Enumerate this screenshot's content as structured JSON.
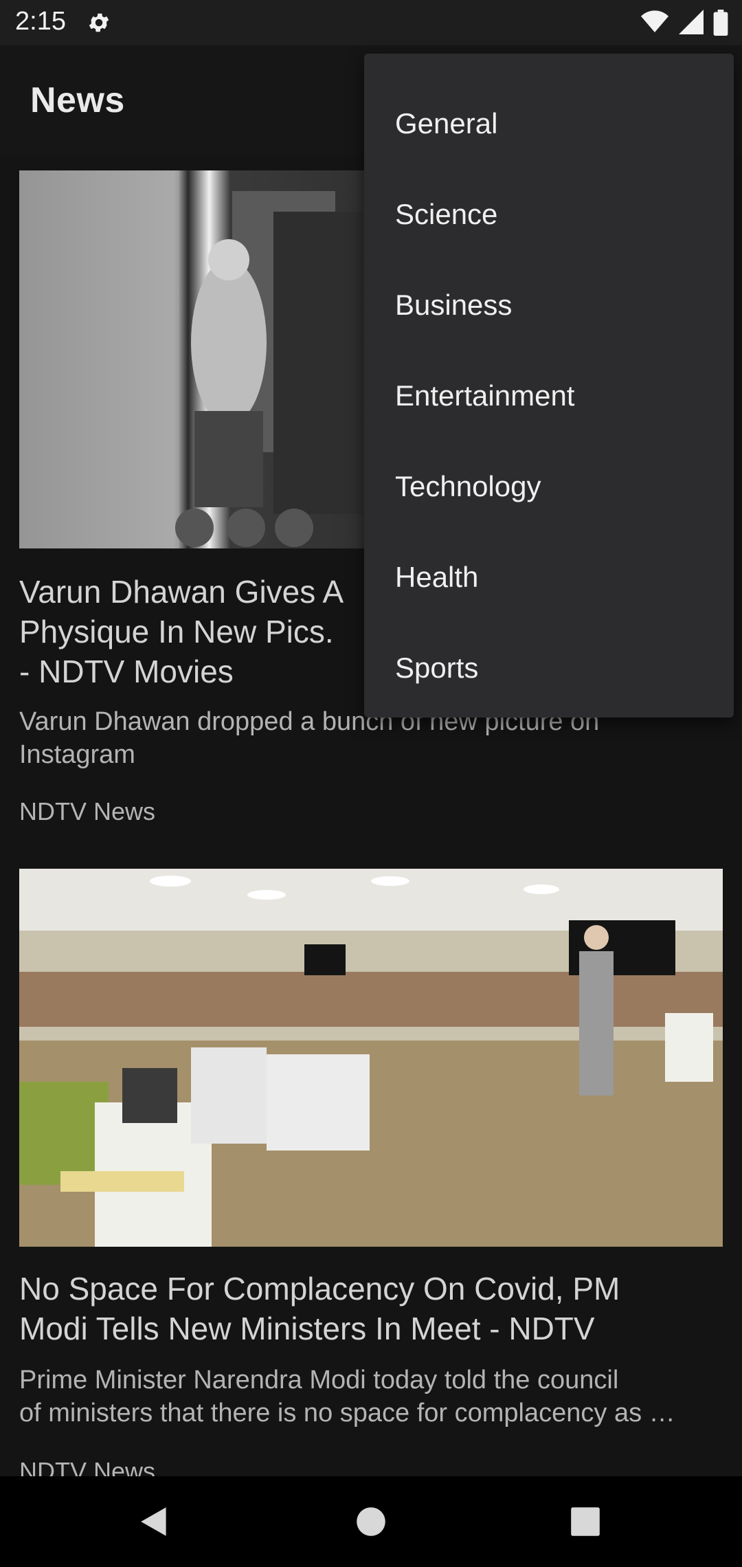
{
  "status_bar": {
    "time": "2:15",
    "icons": [
      "gear-icon",
      "wifi-icon",
      "signal-icon",
      "battery-icon"
    ]
  },
  "app_bar": {
    "title": "News"
  },
  "menu": {
    "items": [
      "General",
      "Science",
      "Business",
      "Entertainment",
      "Technology",
      "Health",
      "Sports"
    ]
  },
  "articles": [
    {
      "title": "Varun Dhawan Gives A\nPhysique In New Pics.\n- NDTV Movies",
      "description": "Varun Dhawan dropped a bunch of new picture on\nInstagram",
      "source": "NDTV News",
      "image": "gym-photo"
    },
    {
      "title": "No Space For Complacency On Covid, PM\nModi Tells New Ministers In Meet - NDTV",
      "description": "Prime Minister Narendra Modi today told the council\nof ministers that there is no space for complacency as …",
      "source": "NDTV News",
      "image": "meeting-photo"
    }
  ],
  "nav_bar": {
    "buttons": [
      "back-icon",
      "home-icon",
      "recents-icon"
    ]
  },
  "colors": {
    "background": "#141414",
    "menu": "#2c2c2e",
    "status_bar": "#1e1e1e"
  }
}
